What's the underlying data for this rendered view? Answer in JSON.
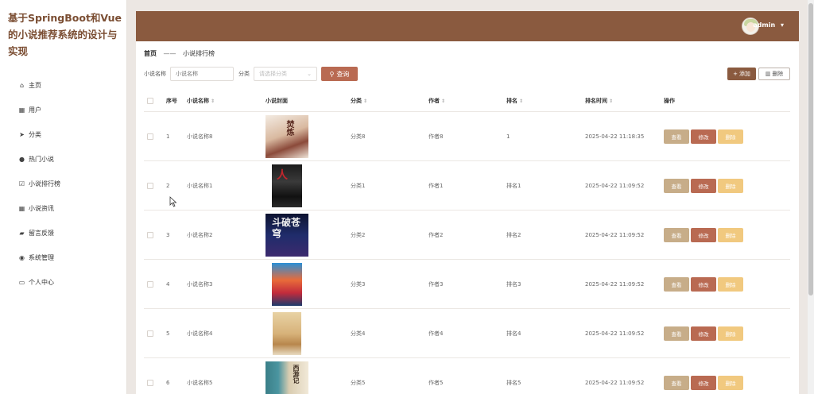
{
  "app": {
    "title": "基于SpringBoot和Vue的小说推荐系统的设计与实现"
  },
  "sidebar": {
    "items": [
      {
        "label": "主页",
        "icon": "home-icon",
        "glyph": "⌂"
      },
      {
        "label": "用户",
        "icon": "grid-icon",
        "glyph": "▦"
      },
      {
        "label": "分类",
        "icon": "send-icon",
        "glyph": "➤"
      },
      {
        "label": "热门小说",
        "icon": "user-icon",
        "glyph": "●"
      },
      {
        "label": "小说排行榜",
        "icon": "check-square-icon",
        "glyph": "☑"
      },
      {
        "label": "小说资讯",
        "icon": "grid-icon",
        "glyph": "▦"
      },
      {
        "label": "留言反馈",
        "icon": "thumbs-up-icon",
        "glyph": "▰"
      },
      {
        "label": "系统管理",
        "icon": "location-icon",
        "glyph": "◉"
      },
      {
        "label": "个人中心",
        "icon": "window-icon",
        "glyph": "▭"
      }
    ]
  },
  "header": {
    "user_name": "admin",
    "dropdown_glyph": "▾"
  },
  "breadcrumb": {
    "home": "首页",
    "separator": "——",
    "current": "小说排行榜"
  },
  "search": {
    "name_label": "小说名称",
    "name_placeholder": "小说名称",
    "category_label": "分类",
    "category_placeholder": "请选择分类",
    "query_label": "查询",
    "add_label": "添加",
    "delete_label": "删除"
  },
  "table": {
    "headers": {
      "index": "序号",
      "name": "小说名称",
      "cover": "小说封面",
      "category": "分类",
      "author": "作者",
      "rank": "排名",
      "rank_time": "排名时间",
      "ops": "操作"
    },
    "sort_glyph": "⇕",
    "op_labels": {
      "view": "查看",
      "edit": "修改",
      "delete": "删除"
    },
    "rows": [
      {
        "index": "1",
        "name": "小说名称8",
        "category": "分类8",
        "author": "作者8",
        "rank": "1",
        "time": "2025-04-22 11:18:35",
        "cover_text": "焚炼"
      },
      {
        "index": "2",
        "name": "小说名称1",
        "category": "分类1",
        "author": "作者1",
        "rank": "排名1",
        "time": "2025-04-22 11:09:52",
        "cover_text": "人"
      },
      {
        "index": "3",
        "name": "小说名称2",
        "category": "分类2",
        "author": "作者2",
        "rank": "排名2",
        "time": "2025-04-22 11:09:52",
        "cover_text": "斗破苍穹"
      },
      {
        "index": "4",
        "name": "小说名称3",
        "category": "分类3",
        "author": "作者3",
        "rank": "排名3",
        "time": "2025-04-22 11:09:52",
        "cover_text": ""
      },
      {
        "index": "5",
        "name": "小说名称4",
        "category": "分类4",
        "author": "作者4",
        "rank": "排名4",
        "time": "2025-04-22 11:09:52",
        "cover_text": ""
      },
      {
        "index": "6",
        "name": "小说名称5",
        "category": "分类5",
        "author": "作者5",
        "rank": "排名5",
        "time": "2025-04-22 11:09:52",
        "cover_text": "西游记"
      }
    ]
  },
  "colors": {
    "header_bg": "#8a5a3f",
    "title_color": "#7b4e33",
    "btn_view": "#c7ad89",
    "btn_edit": "#b96a52",
    "btn_delete": "#f1c97f"
  }
}
